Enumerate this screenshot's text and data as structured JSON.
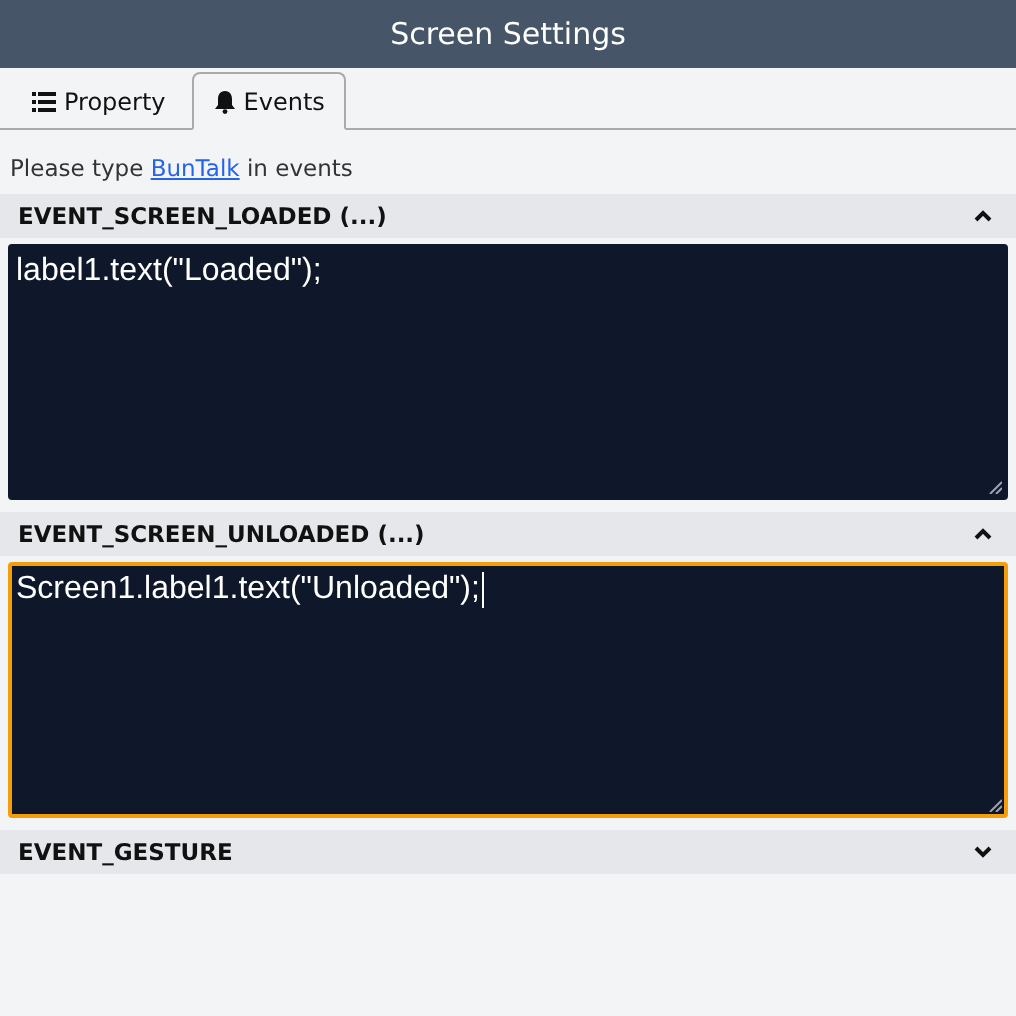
{
  "window": {
    "title": "Screen Settings"
  },
  "tabs": [
    {
      "label": "Property",
      "kind": "list",
      "selected": false
    },
    {
      "label": "Events",
      "kind": "bell",
      "selected": true
    }
  ],
  "hint": {
    "before": "Please type ",
    "link": "BunTalk",
    "after": " in events"
  },
  "sections": [
    {
      "title": "EVENT_SCREEN_LOADED (...)",
      "expanded": true,
      "focused": false,
      "code": "label1.text(\"Loaded\");"
    },
    {
      "title": "EVENT_SCREEN_UNLOADED (...)",
      "expanded": true,
      "focused": true,
      "code": "Screen1.label1.text(\"Unloaded\");"
    },
    {
      "title": "EVENT_GESTURE",
      "expanded": false
    }
  ]
}
